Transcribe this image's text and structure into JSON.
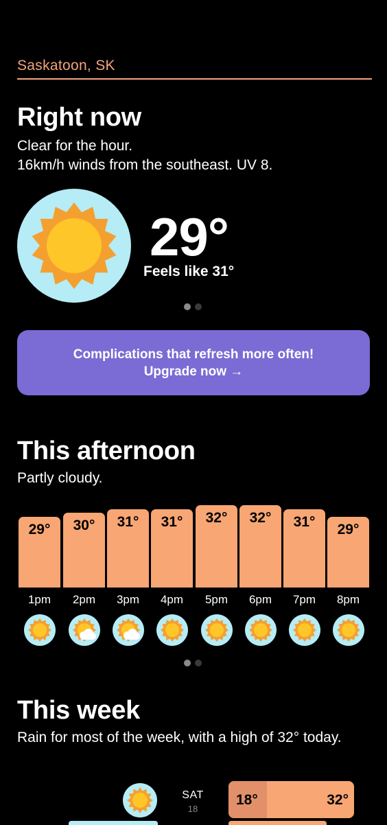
{
  "location": "Saskatoon, SK",
  "right_now": {
    "title": "Right now",
    "line1": "Clear for the hour.",
    "line2": "16km/h winds from the southeast. UV 8.",
    "temp": "29°",
    "feels_like": "Feels like 31°",
    "icon": "sun-icon"
  },
  "promo": {
    "line1": "Complications that refresh more often!",
    "line2": "Upgrade now →"
  },
  "afternoon": {
    "title": "This afternoon",
    "summary": "Partly cloudy.",
    "hours": [
      {
        "time": "1pm",
        "temp": "29°",
        "value": 29,
        "icon": "sun-icon"
      },
      {
        "time": "2pm",
        "temp": "30°",
        "value": 30,
        "icon": "partly-cloudy-icon"
      },
      {
        "time": "3pm",
        "temp": "31°",
        "value": 31,
        "icon": "partly-cloudy-icon"
      },
      {
        "time": "4pm",
        "temp": "31°",
        "value": 31,
        "icon": "sun-icon"
      },
      {
        "time": "5pm",
        "temp": "32°",
        "value": 32,
        "icon": "sun-icon"
      },
      {
        "time": "6pm",
        "temp": "32°",
        "value": 32,
        "icon": "sun-icon"
      },
      {
        "time": "7pm",
        "temp": "31°",
        "value": 31,
        "icon": "sun-icon"
      },
      {
        "time": "8pm",
        "temp": "29°",
        "value": 29,
        "icon": "sun-icon"
      }
    ]
  },
  "week": {
    "title": "This week",
    "summary": "Rain for most of the week, with a high of 32° today.",
    "days": [
      {
        "name": "SAT",
        "date": "18",
        "low": "18°",
        "high": "32°",
        "icon": "sun-icon"
      }
    ]
  },
  "colors": {
    "accent": "#f5a47e",
    "bar": "#f8a674",
    "promo": "#7b6bd4",
    "sky": "#b6ecf5",
    "sun": "#ffc62a",
    "sun_rays": "#f4a030"
  }
}
